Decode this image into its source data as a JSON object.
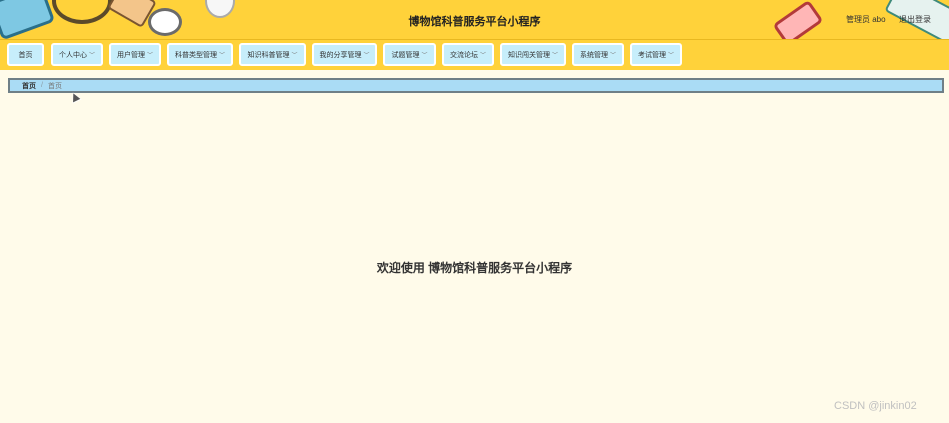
{
  "header": {
    "title": "博物馆科普服务平台小程序",
    "user_label": "管理员 abo",
    "logout_label": "退出登录"
  },
  "nav": {
    "items": [
      {
        "label": "首页",
        "has_dropdown": false
      },
      {
        "label": "个人中心",
        "has_dropdown": true
      },
      {
        "label": "用户管理",
        "has_dropdown": true
      },
      {
        "label": "科普类型管理",
        "has_dropdown": true
      },
      {
        "label": "知识科普管理",
        "has_dropdown": true
      },
      {
        "label": "我的分享管理",
        "has_dropdown": true
      },
      {
        "label": "试题管理",
        "has_dropdown": true
      },
      {
        "label": "交流论坛",
        "has_dropdown": true
      },
      {
        "label": "知识闯关管理",
        "has_dropdown": true
      },
      {
        "label": "系统管理",
        "has_dropdown": true
      },
      {
        "label": "考试管理",
        "has_dropdown": true
      }
    ],
    "dropdown_icon": "chevron-down-icon"
  },
  "breadcrumb": {
    "home": "首页",
    "current": "首页"
  },
  "main": {
    "welcome_text": "欢迎使用 博物馆科普服务平台小程序"
  },
  "watermark": "CSDN @jinkin02",
  "colors": {
    "header_bg": "#ffd23a",
    "nav_item_bg": "#c7eefb",
    "breadcrumb_bg": "#aadcf5",
    "page_bg": "#fffbea"
  }
}
